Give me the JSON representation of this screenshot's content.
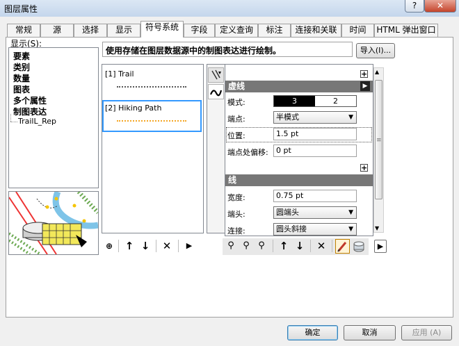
{
  "window": {
    "title": "图层属性",
    "help_label": "?",
    "close_label": "✕"
  },
  "tabs": [
    {
      "label": "常规"
    },
    {
      "label": "源"
    },
    {
      "label": "选择"
    },
    {
      "label": "显示"
    },
    {
      "label": "符号系统",
      "active": true
    },
    {
      "label": "字段"
    },
    {
      "label": "定义查询"
    },
    {
      "label": "标注"
    },
    {
      "label": "连接和关联"
    },
    {
      "label": "时间"
    },
    {
      "label": "HTML 弹出窗口"
    }
  ],
  "show_panel": {
    "label": "显示(S):",
    "items": [
      "要素",
      "类别",
      "数量",
      "图表",
      "多个属性",
      "制图表达"
    ],
    "subitem": "TrailL_Rep"
  },
  "description": "使用存储在图层数据源中的制图表达进行绘制。",
  "import_button": "导入(I)...",
  "representations": [
    {
      "label": "[1] Trail",
      "color": "#555555"
    },
    {
      "label": "[2] Hiking Path",
      "color": "#f5a623"
    }
  ],
  "properties": {
    "dash_section": "虚线",
    "pattern_label": "模式:",
    "pattern_values": [
      "3",
      "2"
    ],
    "endpoints_label": "端点:",
    "endpoints_value": "半模式",
    "position_label": "位置:",
    "position_value": "1.5 pt",
    "offset_label": "端点处偏移:",
    "offset_value": "0 pt",
    "line_section": "线",
    "width_label": "宽度:",
    "width_value": "0.75 pt",
    "cap_label": "端头:",
    "cap_value": "圆端头",
    "join_label": "连接:",
    "join_value": "圆头斜接"
  },
  "dialog_buttons": {
    "ok": "确定",
    "cancel": "取消",
    "apply": "应用 (A)"
  },
  "colors": {
    "selection": "#3399ff",
    "section_header": "#777777"
  }
}
